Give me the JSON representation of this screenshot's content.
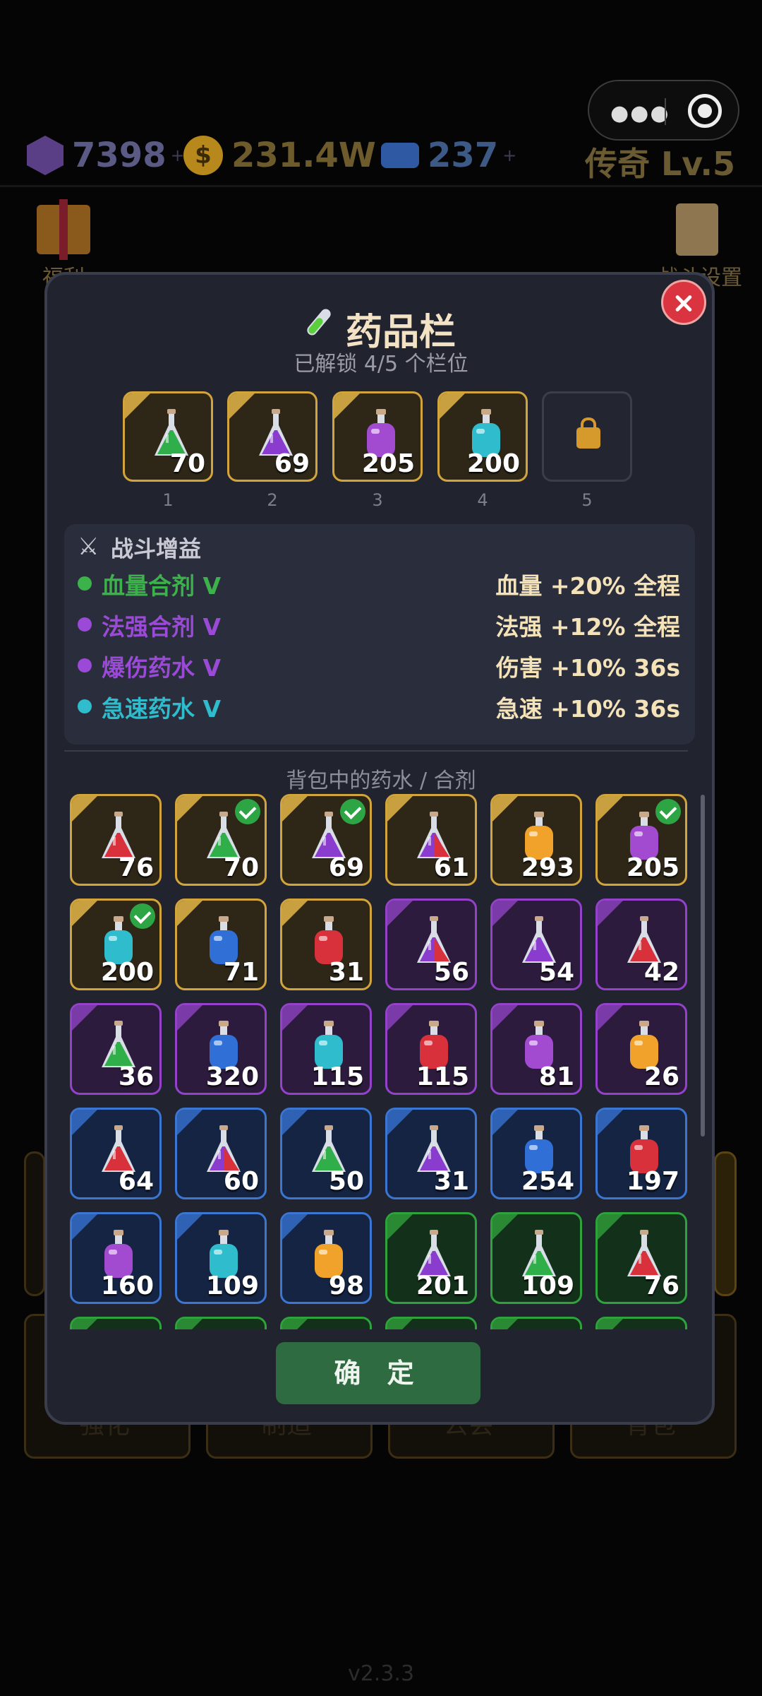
{
  "capsule": {
    "menu_icon": "more-dots-icon",
    "close_icon": "target-icon"
  },
  "resources": {
    "gems": {
      "value": "7398",
      "plus": "+"
    },
    "gold": {
      "value": "231.4W",
      "plus": "+",
      "symbol": "$"
    },
    "tickets": {
      "value": "237",
      "plus": "+"
    },
    "rank": "传奇 Lv.5"
  },
  "background": {
    "welfare_label": "福利",
    "battle_settings_label": "战斗设置",
    "tabs": [
      "强化",
      "制造",
      "公会",
      "背包"
    ]
  },
  "modal": {
    "title": "药品栏",
    "subtitle": "已解锁 4/5 个栏位",
    "close_icon": "close-icon",
    "slots": [
      {
        "num": "1",
        "count": "70",
        "potion": "flask",
        "color": "#2fae4a"
      },
      {
        "num": "2",
        "count": "69",
        "potion": "flask",
        "color": "#8a3ccf"
      },
      {
        "num": "3",
        "count": "205",
        "potion": "bottle",
        "color": "#a24bd0"
      },
      {
        "num": "4",
        "count": "200",
        "potion": "bottle",
        "color": "#2fbccc"
      },
      {
        "num": "5",
        "count": "",
        "locked": true
      }
    ],
    "buffs": {
      "title": "战斗增益",
      "rows": [
        {
          "name": "血量合剂 V",
          "effect": "血量 +20% 全程",
          "color": "#3bb34a"
        },
        {
          "name": "法强合剂 V",
          "effect": "法强 +12% 全程",
          "color": "#9a4ad6"
        },
        {
          "name": "爆伤药水 V",
          "effect": "伤害 +10% 36s",
          "color": "#9a4ad6"
        },
        {
          "name": "急速药水 V",
          "effect": "急速 +10% 36s",
          "color": "#2fbccc"
        }
      ]
    },
    "bag_title": "背包中的药水 / 合剂",
    "confirm": "确 定"
  },
  "bag": [
    {
      "rarity": "gold",
      "count": "76",
      "potion": "flask",
      "color": "#d8313b",
      "checked": false
    },
    {
      "rarity": "gold",
      "count": "70",
      "potion": "flask",
      "color": "#2fae4a",
      "checked": true
    },
    {
      "rarity": "gold",
      "count": "69",
      "potion": "flask",
      "color": "#8a3ccf",
      "checked": true
    },
    {
      "rarity": "gold",
      "count": "61",
      "potion": "flask",
      "color": "#8a3ccf",
      "color2": "#d8313b",
      "checked": false
    },
    {
      "rarity": "gold",
      "count": "293",
      "potion": "bottle",
      "color": "#f0a22a",
      "checked": false
    },
    {
      "rarity": "gold",
      "count": "205",
      "potion": "bottle",
      "color": "#a24bd0",
      "checked": true
    },
    {
      "rarity": "gold",
      "count": "200",
      "potion": "bottle",
      "color": "#2fbccc",
      "checked": true
    },
    {
      "rarity": "gold",
      "count": "71",
      "potion": "bottle",
      "color": "#2f6fd6",
      "checked": false
    },
    {
      "rarity": "gold",
      "count": "31",
      "potion": "bottle",
      "color": "#d8313b",
      "checked": false
    },
    {
      "rarity": "purple",
      "count": "56",
      "potion": "flask",
      "color": "#8a3ccf",
      "color2": "#d8313b",
      "checked": false
    },
    {
      "rarity": "purple",
      "count": "54",
      "potion": "flask",
      "color": "#8a3ccf",
      "checked": false
    },
    {
      "rarity": "purple",
      "count": "42",
      "potion": "flask",
      "color": "#d8313b",
      "checked": false
    },
    {
      "rarity": "purple",
      "count": "36",
      "potion": "flask",
      "color": "#2fae4a",
      "checked": false
    },
    {
      "rarity": "purple",
      "count": "320",
      "potion": "bottle",
      "color": "#2f6fd6",
      "checked": false
    },
    {
      "rarity": "purple",
      "count": "115",
      "potion": "bottle",
      "color": "#2fbccc",
      "checked": false
    },
    {
      "rarity": "purple",
      "count": "115",
      "potion": "bottle",
      "color": "#d8313b",
      "checked": false
    },
    {
      "rarity": "purple",
      "count": "81",
      "potion": "bottle",
      "color": "#a24bd0",
      "checked": false
    },
    {
      "rarity": "purple",
      "count": "26",
      "potion": "bottle",
      "color": "#f0a22a",
      "checked": false
    },
    {
      "rarity": "blue",
      "count": "64",
      "potion": "flask",
      "color": "#d8313b",
      "checked": false
    },
    {
      "rarity": "blue",
      "count": "60",
      "potion": "flask",
      "color": "#8a3ccf",
      "color2": "#d8313b",
      "checked": false
    },
    {
      "rarity": "blue",
      "count": "50",
      "potion": "flask",
      "color": "#2fae4a",
      "checked": false
    },
    {
      "rarity": "blue",
      "count": "31",
      "potion": "flask",
      "color": "#8a3ccf",
      "checked": false
    },
    {
      "rarity": "blue",
      "count": "254",
      "potion": "bottle",
      "color": "#2f6fd6",
      "checked": false
    },
    {
      "rarity": "blue",
      "count": "197",
      "potion": "bottle",
      "color": "#d8313b",
      "checked": false
    },
    {
      "rarity": "blue",
      "count": "160",
      "potion": "bottle",
      "color": "#a24bd0",
      "checked": false
    },
    {
      "rarity": "blue",
      "count": "109",
      "potion": "bottle",
      "color": "#2fbccc",
      "checked": false
    },
    {
      "rarity": "blue",
      "count": "98",
      "potion": "bottle",
      "color": "#f0a22a",
      "checked": false
    },
    {
      "rarity": "green",
      "count": "201",
      "potion": "flask",
      "color": "#8a3ccf",
      "checked": false
    },
    {
      "rarity": "green",
      "count": "109",
      "potion": "flask",
      "color": "#2fae4a",
      "checked": false
    },
    {
      "rarity": "green",
      "count": "76",
      "potion": "flask",
      "color": "#d8313b",
      "checked": false
    },
    {
      "rarity": "green",
      "count": "",
      "potion": "",
      "color": "#2fae4a",
      "checked": false
    },
    {
      "rarity": "green",
      "count": "",
      "potion": "",
      "color": "#2fae4a",
      "checked": false
    },
    {
      "rarity": "green",
      "count": "",
      "potion": "",
      "color": "#2fae4a",
      "checked": false
    },
    {
      "rarity": "green",
      "count": "",
      "potion": "",
      "color": "#2fae4a",
      "checked": false
    },
    {
      "rarity": "green",
      "count": "",
      "potion": "",
      "color": "#2fae4a",
      "checked": false
    },
    {
      "rarity": "green",
      "count": "",
      "potion": "",
      "color": "#2fae4a",
      "checked": false
    }
  ],
  "version": "v2.3.3"
}
